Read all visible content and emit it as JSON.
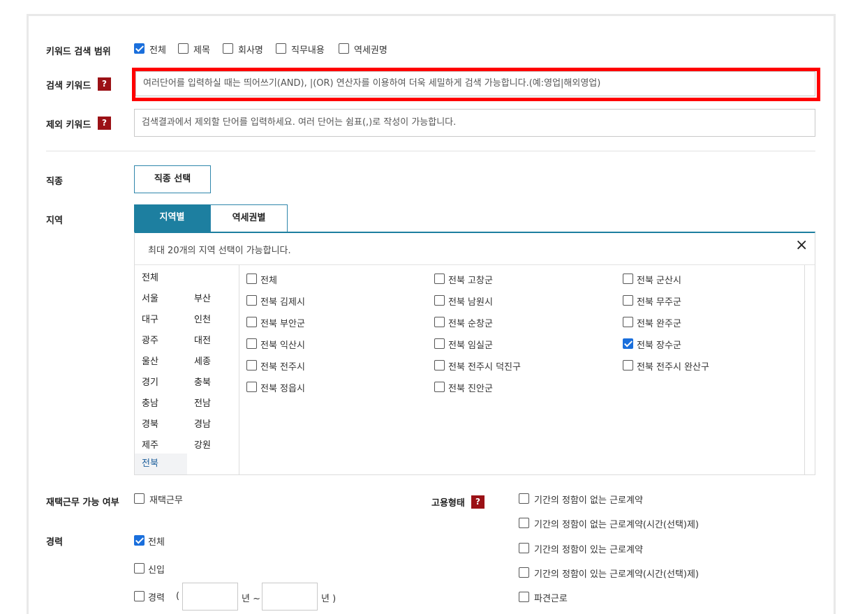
{
  "keyword_scope": {
    "label": "키워드 검색 범위",
    "options": [
      {
        "label": "전체",
        "checked": true
      },
      {
        "label": "제목",
        "checked": false
      },
      {
        "label": "회사명",
        "checked": false
      },
      {
        "label": "직무내용",
        "checked": false
      },
      {
        "label": "역세권명",
        "checked": false
      }
    ]
  },
  "search_keyword": {
    "label": "검색 키워드",
    "help": "?",
    "placeholder": "여러단어를 입력하실 때는 띄어쓰기(AND), |(OR) 연산자를 이용하여 더욱 세밀하게 검색 가능합니다.(예:영업|해외영업)"
  },
  "exclude_keyword": {
    "label": "제외 키워드",
    "help": "?",
    "placeholder": "검색결과에서 제외할 단어를 입력하세요. 여러 단어는 쉼표(,)로 작성이 가능합니다."
  },
  "job_type": {
    "label": "직종",
    "button": "직종 선택"
  },
  "region": {
    "label": "지역",
    "tabs": [
      "지역별",
      "역세권별"
    ],
    "notice": "최대 20개의 지역 선택이 가능합니다.",
    "close_icon": "×",
    "provinces_all": "전체",
    "provinces": [
      [
        "서울",
        "부산"
      ],
      [
        "대구",
        "인천"
      ],
      [
        "광주",
        "대전"
      ],
      [
        "울산",
        "세종"
      ],
      [
        "경기",
        "충북"
      ],
      [
        "충남",
        "전남"
      ],
      [
        "경북",
        "경남"
      ],
      [
        "제주",
        "강원"
      ]
    ],
    "selected_province": "전북",
    "districts": [
      [
        {
          "label": "전체",
          "checked": false
        },
        {
          "label": "전북 고창군",
          "checked": false
        },
        {
          "label": "전북 군산시",
          "checked": false
        }
      ],
      [
        {
          "label": "전북 김제시",
          "checked": false
        },
        {
          "label": "전북 남원시",
          "checked": false
        },
        {
          "label": "전북 무주군",
          "checked": false
        }
      ],
      [
        {
          "label": "전북 부안군",
          "checked": false
        },
        {
          "label": "전북 순창군",
          "checked": false
        },
        {
          "label": "전북 완주군",
          "checked": false
        }
      ],
      [
        {
          "label": "전북 익산시",
          "checked": false
        },
        {
          "label": "전북 임실군",
          "checked": false
        },
        {
          "label": "전북 장수군",
          "checked": true
        }
      ],
      [
        {
          "label": "전북 전주시",
          "checked": false
        },
        {
          "label": "전북 전주시 덕진구",
          "checked": false
        },
        {
          "label": "전북 전주시 완산구",
          "checked": false
        }
      ],
      [
        {
          "label": "전북 정읍시",
          "checked": false
        },
        {
          "label": "전북 진안군",
          "checked": false
        }
      ]
    ]
  },
  "remote_work": {
    "label": "재택근무 가능 여부",
    "option": "재택근무",
    "checked": false
  },
  "career": {
    "label": "경력",
    "options": [
      {
        "label": "전체",
        "checked": true
      },
      {
        "label": "신입",
        "checked": false
      },
      {
        "label": "경력",
        "checked": false
      }
    ],
    "open_paren": "(",
    "year_from_suffix": "년 ~",
    "year_to_suffix": "년 )"
  },
  "employment_type": {
    "label": "고용형태",
    "help": "?",
    "options": [
      {
        "label": "기간의 정함이 없는 근로계약",
        "checked": false
      },
      {
        "label": "기간의 정함이 없는 근로계약(시간(선택)제)",
        "checked": false
      },
      {
        "label": "기간의 정함이 있는 근로계약",
        "checked": false
      },
      {
        "label": "기간의 정함이 있는 근로계약(시간(선택)제)",
        "checked": false
      },
      {
        "label": "파견근로",
        "checked": false
      }
    ]
  },
  "colors": {
    "accent": "#1d7fa0",
    "checkbox": "#1a6fdc",
    "help_badge": "#9b1116",
    "highlight": "#ff0000"
  }
}
